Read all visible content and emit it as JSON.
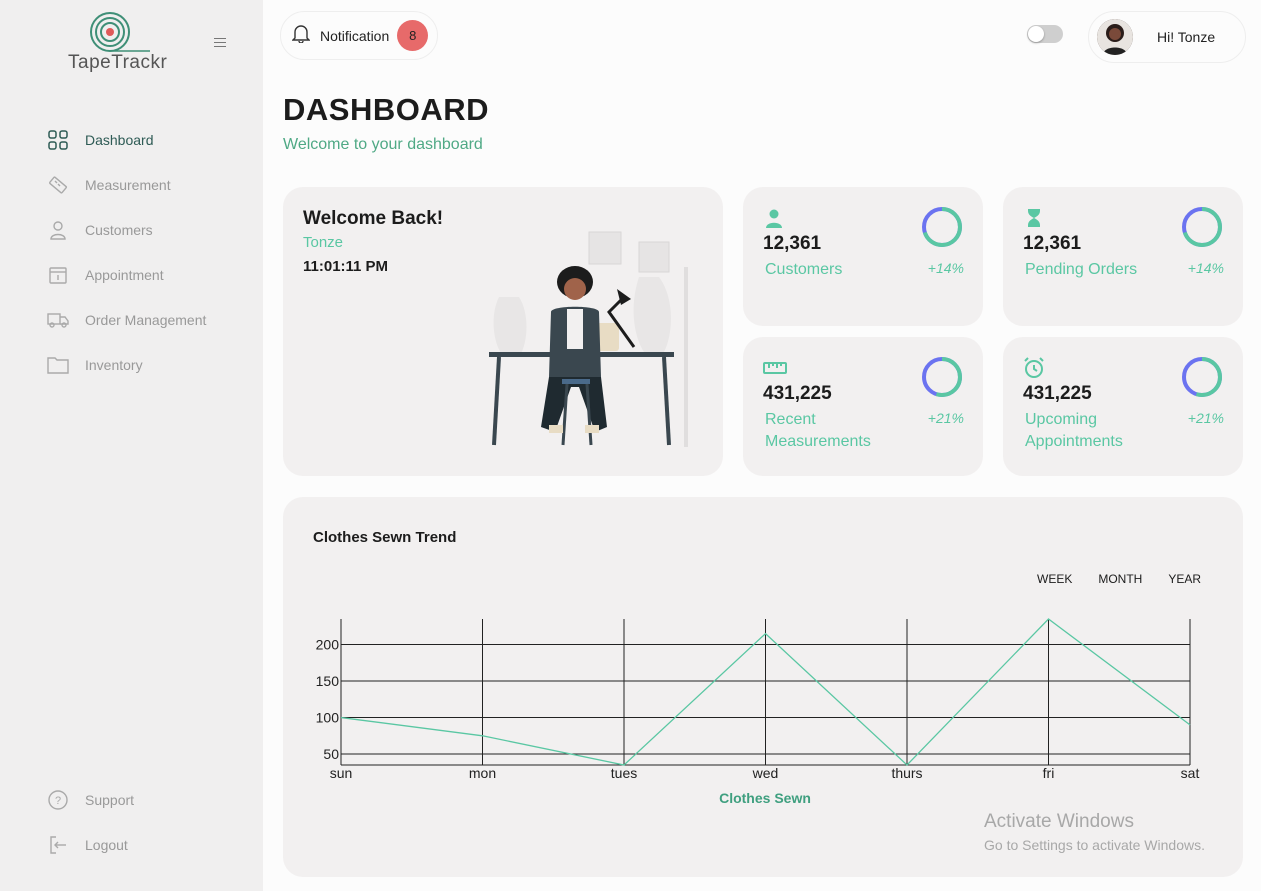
{
  "app": {
    "logo_text": "TapeTrackr"
  },
  "sidebar": {
    "items": [
      {
        "label": "Dashboard",
        "icon": "dashboard-grid-icon",
        "active": true
      },
      {
        "label": "Measurement",
        "icon": "tape-measure-icon"
      },
      {
        "label": "Customers",
        "icon": "user-icon"
      },
      {
        "label": "Appointment",
        "icon": "calendar-icon"
      },
      {
        "label": "Order Management",
        "icon": "truck-icon"
      },
      {
        "label": "Inventory",
        "icon": "folder-icon"
      }
    ],
    "bottom": [
      {
        "label": "Support",
        "icon": "help-circle-icon"
      },
      {
        "label": "Logout",
        "icon": "logout-icon"
      }
    ]
  },
  "topbar": {
    "notification_label": "Notification",
    "notification_count": "8",
    "greeting": "Hi! Tonze"
  },
  "page": {
    "title": "DASHBOARD",
    "subtitle": "Welcome to your dashboard"
  },
  "welcome": {
    "heading": "Welcome Back!",
    "name": "Tonze",
    "time": "11:01:11 PM"
  },
  "stats": [
    {
      "value": "12,361",
      "label": "Customers",
      "change": "+14%",
      "icon": "user-icon",
      "progress": 0.7
    },
    {
      "value": "12,361",
      "label": "Pending Orders",
      "change": "+14%",
      "icon": "hourglass-icon",
      "progress": 0.7
    },
    {
      "value": "431,225",
      "label": "Recent Measurements",
      "change": "+21%",
      "icon": "ruler-icon",
      "progress": 0.55
    },
    {
      "value": "431,225",
      "label": "Upcoming Appointments",
      "change": "+21%",
      "icon": "alarm-clock-icon",
      "progress": 0.55
    }
  ],
  "chart": {
    "title": "Clothes Sewn Trend",
    "ranges": [
      "WEEK",
      "MONTH",
      "YEAR"
    ]
  },
  "colors": {
    "accent": "#5ac7a3",
    "ring_secondary": "#6b73f0",
    "badge": "#e76a6a"
  },
  "chart_data": {
    "type": "line",
    "title": "Clothes Sewn Trend",
    "xlabel": "Clothes Sewn",
    "ylabel": "",
    "categories": [
      "sun",
      "mon",
      "tues",
      "wed",
      "thurs",
      "fri",
      "sat"
    ],
    "series": [
      {
        "values": [
          100,
          75,
          35,
          215,
          35,
          235,
          90
        ]
      }
    ],
    "yticks": [
      50,
      100,
      150,
      200
    ],
    "ylim": [
      35,
      235
    ],
    "grid": true
  },
  "watermark": {
    "line1": "Activate Windows",
    "line2": "Go to Settings to activate Windows."
  }
}
